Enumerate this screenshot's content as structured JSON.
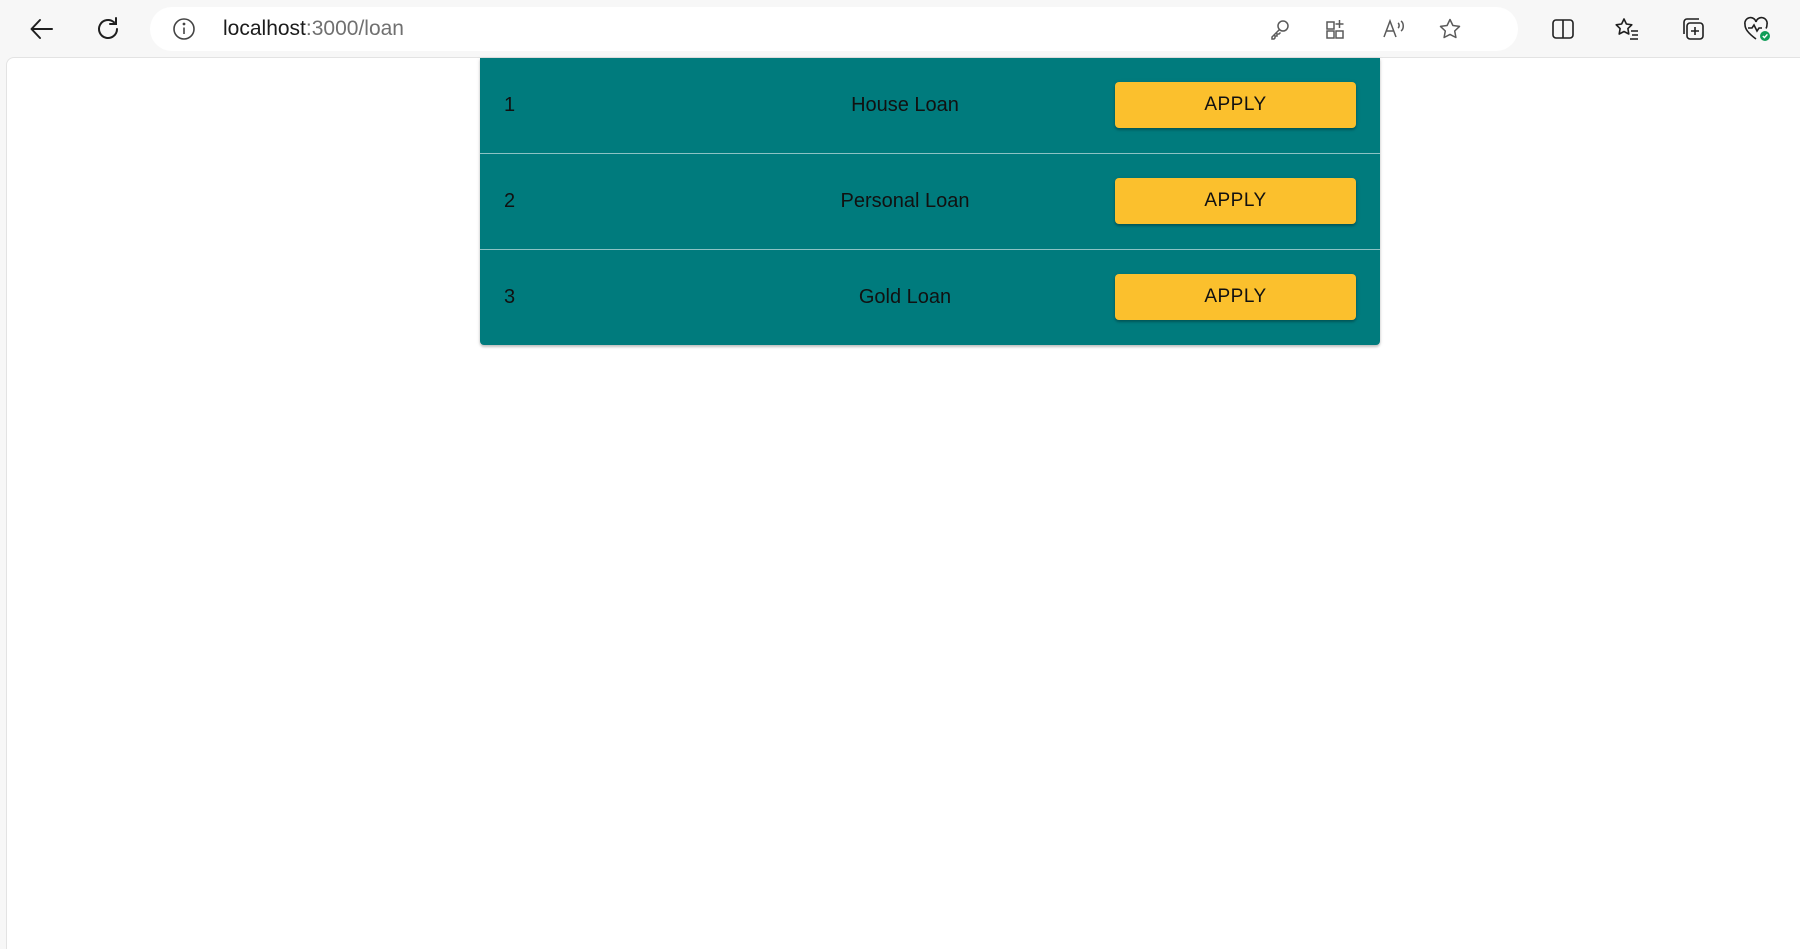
{
  "browser": {
    "address": {
      "host": "localhost",
      "path": ":3000/loan"
    },
    "toolbar_icons": [
      "back-icon",
      "refresh-icon",
      "site-info-icon",
      "key-icon",
      "apps-icon",
      "read-aloud-icon",
      "favorite-star-icon",
      "split-screen-icon",
      "favorites-icon",
      "collections-icon",
      "browser-essentials-icon"
    ]
  },
  "loans": [
    {
      "id": "1",
      "name": "House Loan",
      "action": "APPLY"
    },
    {
      "id": "2",
      "name": "Personal Loan",
      "action": "APPLY"
    },
    {
      "id": "3",
      "name": "Gold Loan",
      "action": "APPLY"
    }
  ],
  "colors": {
    "table_background": "#007b7d",
    "apply_button": "#fbc02d",
    "page_background": "#ffffff"
  }
}
